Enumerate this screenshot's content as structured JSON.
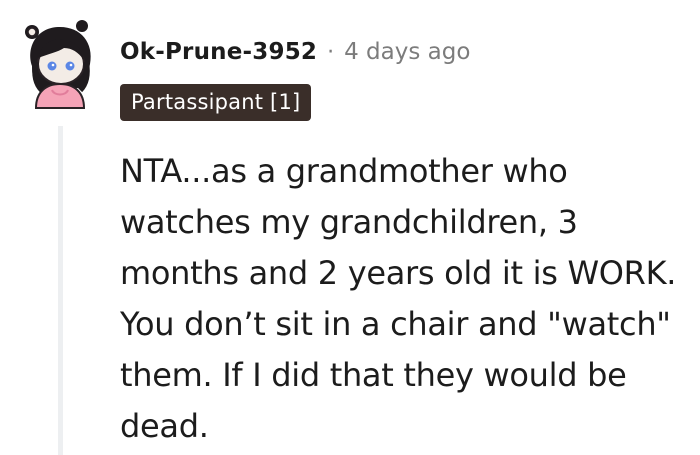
{
  "comment": {
    "username": "Ok-Prune-3952",
    "separator": "·",
    "timestamp": "4 days ago",
    "flair": "Partassipant [1]",
    "body": "NTA...as a grandmother who\nwatches my grandchildren, 3\nmonths and 2 years old it is WORK.\nYou don’t sit in a chair and \"watch\"\nthem. If I did that they would be\ndead."
  },
  "avatar": {
    "icon": "snoo-avatar-icon",
    "skin_color": "#f3ece6",
    "hair_color": "#1f1b1e",
    "eye_color": "#5b86e5",
    "shirt_color": "#f5a3b7",
    "outline_color": "#2a2226"
  },
  "colors": {
    "text": "#1c1c1c",
    "meta": "#7c7c7c",
    "flair_bg": "#3a2e29",
    "flair_text": "#ffffff",
    "thread_line": "#edeff1"
  }
}
